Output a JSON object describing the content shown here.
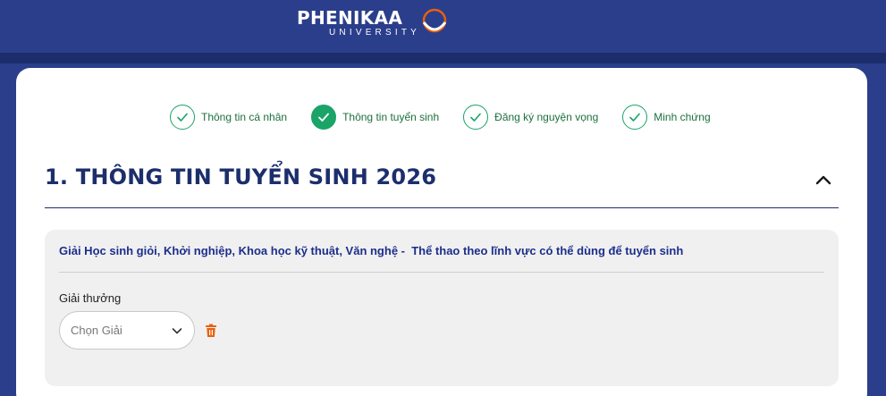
{
  "header": {
    "logo": {
      "name": "PHENIKAA",
      "subtitle": "UNIVERSITY"
    }
  },
  "stepper": {
    "steps": [
      {
        "label": "Thông tin cá nhân",
        "state": "completed"
      },
      {
        "label": "Thông tin tuyển sinh",
        "state": "active"
      },
      {
        "label": "Đăng ký nguyện vọng",
        "state": "completed"
      },
      {
        "label": "Minh chứng",
        "state": "completed"
      }
    ]
  },
  "section": {
    "title": "1. THÔNG TIN TUYỂN SINH 2026",
    "collapse_icon": "chevron-up-icon"
  },
  "panel": {
    "heading": "Giải Học sinh giỏi, Khởi nghiệp, Khoa học kỹ thuật, Văn nghệ -  Thể thao theo lĩnh vực có thể dùng để tuyển sinh",
    "field_label": "Giải thưởng",
    "select_value": "Chọn Giải",
    "delete_icon": "trash-icon"
  },
  "colors": {
    "header_bg": "#2b3e8c",
    "header_band": "#1d2d6b",
    "title": "#1c2e6b",
    "step_green": "#1ba468",
    "step_text": "#1d6f3d",
    "panel_bg": "#f0f0f0",
    "heading_blue": "#1c2e8c",
    "trash": "#e8600c",
    "logo_ring": "#e8600c"
  }
}
